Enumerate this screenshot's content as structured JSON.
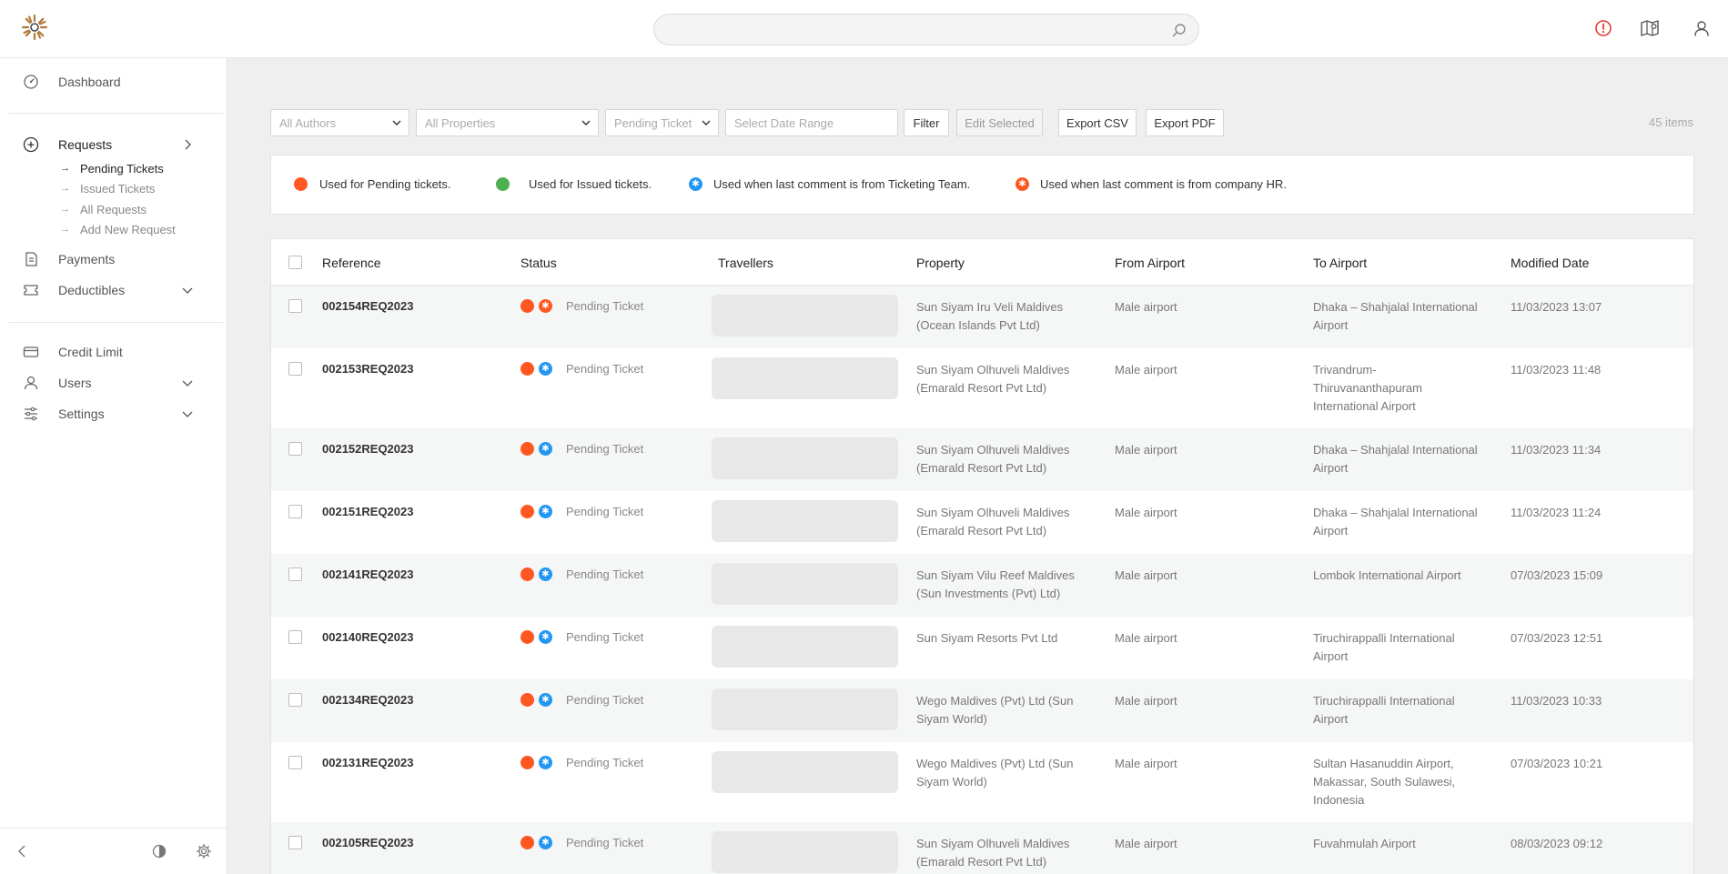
{
  "search": {
    "placeholder": ""
  },
  "sidebar": {
    "items": [
      {
        "label": "Dashboard"
      },
      {
        "label": "Requests"
      },
      {
        "label": "Payments"
      },
      {
        "label": "Deductibles"
      },
      {
        "label": "Credit Limit"
      },
      {
        "label": "Users"
      },
      {
        "label": "Settings"
      }
    ],
    "subitems": [
      {
        "label": "Pending Tickets",
        "active": true
      },
      {
        "label": "Issued Tickets"
      },
      {
        "label": "All Requests"
      },
      {
        "label": "Add New Request"
      }
    ]
  },
  "toolbar": {
    "authors": "All Authors",
    "properties": "All Properties",
    "status": "Pending Ticket",
    "date_placeholder": "Select Date Range",
    "filter": "Filter",
    "edit_selected": "Edit Selected",
    "export_csv": "Export CSV",
    "export_pdf": "Export PDF",
    "items_count": "45 items"
  },
  "legend": {
    "pending": "Used for Pending tickets.",
    "issued": "Used for Issued tickets.",
    "ticketing": "Used when last comment is from Ticketing Team.",
    "hr": "Used when last comment is from company HR."
  },
  "table": {
    "headers": [
      "Reference",
      "Status",
      "Travellers",
      "Property",
      "From Airport",
      "To Airport",
      "Modified Date"
    ],
    "rows": [
      {
        "ref": "002154REQ2023",
        "comment": "hr",
        "status": "Pending Ticket",
        "property": "Sun Siyam Iru Veli Maldives (Ocean Islands Pvt Ltd)",
        "from": "Male airport",
        "to": "Dhaka – Shahjalal International Airport",
        "modified": "11/03/2023 13:07"
      },
      {
        "ref": "002153REQ2023",
        "comment": "ticketing",
        "status": "Pending Ticket",
        "property": "Sun Siyam Olhuveli Maldives (Emarald Resort Pvt Ltd)",
        "from": "Male airport",
        "to": "Trivandrum-Thiruvananthapuram International Airport",
        "modified": "11/03/2023 11:48"
      },
      {
        "ref": "002152REQ2023",
        "comment": "ticketing",
        "status": "Pending Ticket",
        "property": "Sun Siyam Olhuveli Maldives (Emarald Resort Pvt Ltd)",
        "from": "Male airport",
        "to": "Dhaka – Shahjalal International Airport",
        "modified": "11/03/2023 11:34"
      },
      {
        "ref": "002151REQ2023",
        "comment": "ticketing",
        "status": "Pending Ticket",
        "property": "Sun Siyam Olhuveli Maldives (Emarald Resort Pvt Ltd)",
        "from": "Male airport",
        "to": "Dhaka – Shahjalal International Airport",
        "modified": "11/03/2023 11:24"
      },
      {
        "ref": "002141REQ2023",
        "comment": "ticketing",
        "status": "Pending Ticket",
        "property": "Sun Siyam Vilu Reef Maldives (Sun Investments (Pvt) Ltd)",
        "from": "Male airport",
        "to": "Lombok International Airport",
        "modified": "07/03/2023 15:09"
      },
      {
        "ref": "002140REQ2023",
        "comment": "ticketing",
        "status": "Pending Ticket",
        "property": "Sun Siyam Resorts Pvt Ltd",
        "from": "Male airport",
        "to": "Tiruchirappalli International Airport",
        "modified": "07/03/2023 12:51"
      },
      {
        "ref": "002134REQ2023",
        "comment": "ticketing",
        "status": "Pending Ticket",
        "property": "Wego Maldives (Pvt) Ltd (Sun Siyam World)",
        "from": "Male airport",
        "to": "Tiruchirappalli International Airport",
        "modified": "11/03/2023 10:33"
      },
      {
        "ref": "002131REQ2023",
        "comment": "ticketing",
        "status": "Pending Ticket",
        "property": "Wego Maldives (Pvt) Ltd (Sun Siyam World)",
        "from": "Male airport",
        "to": "Sultan Hasanuddin Airport, Makassar, South Sulawesi, Indonesia",
        "modified": "07/03/2023 10:21"
      },
      {
        "ref": "002105REQ2023",
        "comment": "ticketing",
        "status": "Pending Ticket",
        "property": "Sun Siyam Olhuveli Maldives (Emarald Resort Pvt Ltd)",
        "from": "Male airport",
        "to": "Fuvahmulah Airport",
        "modified": "08/03/2023 09:12"
      }
    ]
  },
  "colors": {
    "pending": "#ff5722",
    "issued": "#4caf50",
    "ticketing": "#2196f3",
    "hr": "#ff5722"
  }
}
